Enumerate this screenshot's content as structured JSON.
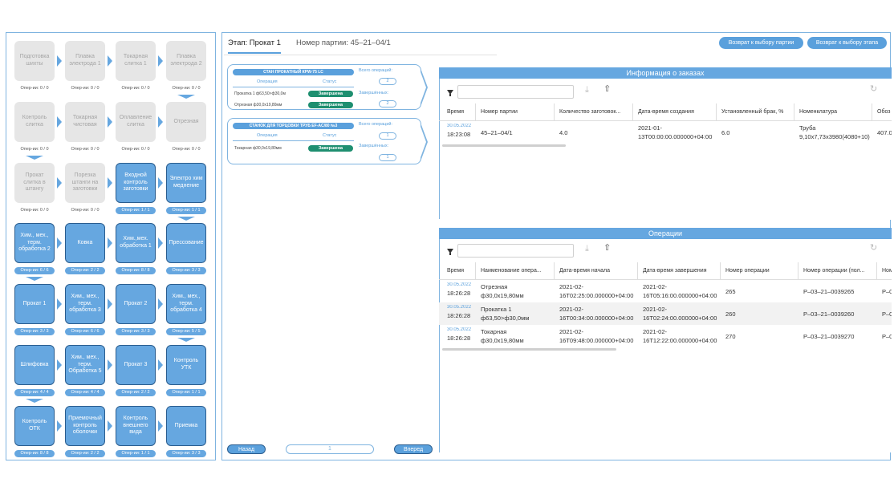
{
  "flow": {
    "stages": [
      {
        "label": "Подготовка шихты",
        "count": "Опер-ии: 0 / 0",
        "state": "pending"
      },
      {
        "label": "Плавка электрода 1",
        "count": "Опер-ии: 0 / 0",
        "state": "pending"
      },
      {
        "label": "Токарная слитка 1",
        "count": "Опер-ии: 0 / 0",
        "state": "pending"
      },
      {
        "label": "Плавка электрода 2",
        "count": "Опер-ии: 0 / 0",
        "state": "pending"
      },
      {
        "label": "Контроль слитка",
        "count": "Опер-ии: 0 / 0",
        "state": "pending"
      },
      {
        "label": "Токарная чистовая",
        "count": "Опер-ии: 0 / 0",
        "state": "pending"
      },
      {
        "label": "Оплавление слитка",
        "count": "Опер-ии: 0 / 0",
        "state": "pending"
      },
      {
        "label": "Отрезная",
        "count": "Опер-ии: 0 / 0",
        "state": "pending"
      },
      {
        "label": "Прокат слитка в штангу",
        "count": "Опер-ии: 0 / 0",
        "state": "pending"
      },
      {
        "label": "Порезка штанги на заготовки",
        "count": "Опер-ии: 0 / 0",
        "state": "pending"
      },
      {
        "label": "Входной контроль заготовки",
        "count": "Опер-ии: 1 / 1",
        "state": "active"
      },
      {
        "label": "Электро хим меднение",
        "count": "Опер-ии: 1 / 1",
        "state": "active"
      },
      {
        "label": "Хим., мех., терм. обработка 2",
        "count": "Опер-ии: 6 / 6",
        "state": "active"
      },
      {
        "label": "Ковка",
        "count": "Опер-ии: 2 / 2",
        "state": "active"
      },
      {
        "label": "Хим.,мех. обработка 1",
        "count": "Опер-ии: 8 / 8",
        "state": "active"
      },
      {
        "label": "Прессование",
        "count": "Опер-ии: 3 / 3",
        "state": "active"
      },
      {
        "label": "Прокат 1",
        "count": "Опер-ии: 3 / 3",
        "state": "active"
      },
      {
        "label": "Хим., мех., терм. обработка 3",
        "count": "Опер-ии: 6 / 6",
        "state": "active"
      },
      {
        "label": "Прокат 2",
        "count": "Опер-ии: 3 / 3",
        "state": "active"
      },
      {
        "label": "Хим., мех., терм. обработка 4",
        "count": "Опер-ии: 5 / 5",
        "state": "active"
      },
      {
        "label": "Шлифовка",
        "count": "Опер-ии: 4 / 4",
        "state": "active"
      },
      {
        "label": "Хим., мех., терм. Обработка 5",
        "count": "Опер-ии: 4 / 4",
        "state": "active"
      },
      {
        "label": "Прокат 3",
        "count": "Опер-ии: 2 / 2",
        "state": "active"
      },
      {
        "label": "Контроль УТК",
        "count": "Опер-ии: 1 / 1",
        "state": "active"
      },
      {
        "label": "Контроль ОТК",
        "count": "Опер-ии: 8 / 8",
        "state": "active"
      },
      {
        "label": "Приемочный контроль оболочки",
        "count": "Опер-ии: 2 / 2",
        "state": "active"
      },
      {
        "label": "Контроль внешнего вида",
        "count": "Опер-ии: 1 / 1",
        "state": "active"
      },
      {
        "label": "Приемка",
        "count": "Опер-ии: 3 / 3",
        "state": "active"
      }
    ]
  },
  "header": {
    "stage": "Этап: Прокат 1",
    "batch": "Номер партии: 45–21–04/1",
    "btn_back_batch": "Возврат к выбору партии",
    "btn_back_stage": "Возврат к выбору этапа"
  },
  "machines": [
    {
      "title": "СТАН ПРОКАТНЫЙ КРW-75 LC",
      "col_op": "Операция",
      "col_status": "Статус",
      "ops": [
        {
          "name": "Прокатка 1 ф63,50>ф30,0м",
          "status": "Завершена"
        },
        {
          "name": "Отрезная ф30,0х19,80мм",
          "status": "Завершена"
        }
      ],
      "total_label": "Всего операций:",
      "total": "2",
      "done_label": "Завершённых:",
      "done": "2"
    },
    {
      "title": "СТАНОК ДЛЯ ТОРЦОВКИ ТРУБ EF-AC/80 №3",
      "col_op": "Операция",
      "col_status": "Статус",
      "ops": [
        {
          "name": "Токарная ф30,0х19,80мм",
          "status": "Завершена"
        }
      ],
      "total_label": "Всего операций:",
      "total": "1",
      "done_label": "Завершённых:",
      "done": "1"
    }
  ],
  "pager": {
    "prev": "Назад",
    "page": "1",
    "next": "Вперед"
  },
  "orders": {
    "title": "Информация о заказах",
    "headers": [
      "Время",
      "Номер партии",
      "Количество заготовок...",
      "Дата-время создания",
      "Установленный брак, %",
      "Номенклатура",
      "Обоз"
    ],
    "rows": [
      {
        "date": "30.05.2022",
        "time": "18:23:08",
        "batch": "45–21–04/1",
        "qty": "4.0",
        "created1": "2021-01-",
        "created2": "13T00:00:00.000000+04:00",
        "defect": "6.0",
        "nom1": "Труба",
        "nom2": "9,10х7,73х3980(4080+10)",
        "extra": "407.0"
      }
    ]
  },
  "operations": {
    "title": "Операции",
    "headers": [
      "Время",
      "Наименование опера...",
      "Дата-время начала",
      "Дата-время завершения",
      "Номер операции",
      "Номер операции (пол...",
      "Ном"
    ],
    "rows": [
      {
        "date": "30.05.2022",
        "time": "18:26:28",
        "name1": "Отрезная",
        "name2": "ф30,0х19,80мм",
        "start1": "2021-02-",
        "start2": "16T02:25:00.000000+04:00",
        "end1": "2021-02-",
        "end2": "16T05:16:00.000000+04:00",
        "num": "265",
        "full": "P–03–21–0039265",
        "extra": "P–0"
      },
      {
        "date": "30.05.2022",
        "time": "18:26:28",
        "name1": "Прокатка 1",
        "name2": "ф63,50>ф30,0мм",
        "start1": "2021-02-",
        "start2": "16T00:34:00.000000+04:00",
        "end1": "2021-02-",
        "end2": "16T02:24:00.000000+04:00",
        "num": "260",
        "full": "P–03–21–0039260",
        "extra": "P–0"
      },
      {
        "date": "30.05.2022",
        "time": "18:26:28",
        "name1": "Токарная",
        "name2": "ф30,0х19,80мм",
        "start1": "2021-02-",
        "start2": "16T09:48:00.000000+04:00",
        "end1": "2021-02-",
        "end2": "16T12:22:00.000000+04:00",
        "num": "270",
        "full": "P–03–21–0039270",
        "extra": "P–0"
      }
    ]
  }
}
